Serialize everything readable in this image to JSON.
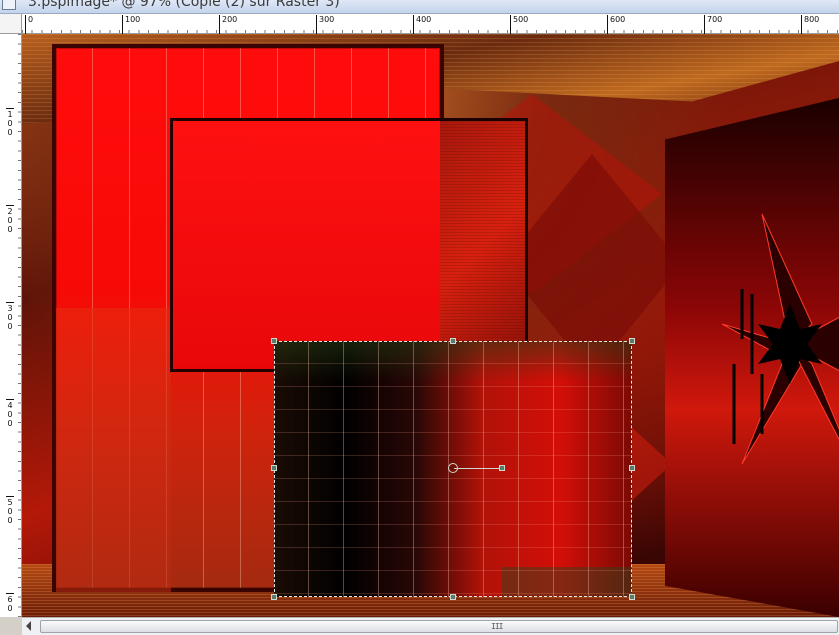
{
  "window": {
    "title": "3.pspimage* @  97% (Copie (2) sur Raster 3)"
  },
  "ruler": {
    "horizontal_labels": [
      "0",
      "100",
      "200",
      "300",
      "400",
      "500",
      "600",
      "700",
      "800"
    ],
    "vertical_labels": [
      "1\n0\n0",
      "2\n0\n0",
      "3\n0\n0",
      "4\n0\n0",
      "5\n0\n0",
      "6\n0"
    ]
  },
  "scrollbar": {
    "grip": "III"
  },
  "colors": {
    "primary_red": "#ff0c0c",
    "dark_border": "#3a0402",
    "selection_handle": "#5a7a6a"
  }
}
